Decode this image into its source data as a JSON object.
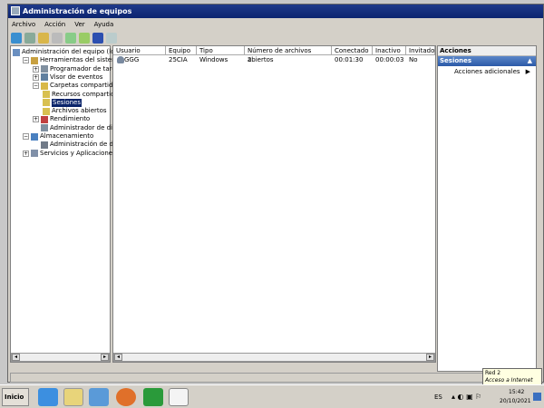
{
  "window": {
    "title": "Administración de equipos"
  },
  "menu": [
    "Archivo",
    "Acción",
    "Ver",
    "Ayuda"
  ],
  "tree": [
    {
      "label": "Administración del equipo (local)",
      "level": 0,
      "exp": ""
    },
    {
      "label": "Herramientas del sistema",
      "level": 1,
      "exp": "−"
    },
    {
      "label": "Programador de tareas",
      "level": 2,
      "exp": "+"
    },
    {
      "label": "Visor de eventos",
      "level": 2,
      "exp": "+"
    },
    {
      "label": "Carpetas compartidas",
      "level": 2,
      "exp": "−"
    },
    {
      "label": "Recursos compartidos",
      "level": 3,
      "exp": ""
    },
    {
      "label": "Sesiones",
      "level": 3,
      "exp": "",
      "selected": true
    },
    {
      "label": "Archivos abiertos",
      "level": 3,
      "exp": ""
    },
    {
      "label": "Rendimiento",
      "level": 2,
      "exp": "+"
    },
    {
      "label": "Administrador de dispositi",
      "level": 2,
      "exp": ""
    },
    {
      "label": "Almacenamiento",
      "level": 1,
      "exp": "−"
    },
    {
      "label": "Administración de discos",
      "level": 2,
      "exp": ""
    },
    {
      "label": "Servicios y Aplicaciones",
      "level": 1,
      "exp": "+"
    }
  ],
  "list": {
    "columns": [
      "Usuario",
      "Equipo",
      "Tipo",
      "Número de archivos abiertos",
      "Conectado",
      "Inactivo",
      "Invitado"
    ],
    "rows": [
      [
        "GGG",
        "25CIA",
        "Windows",
        "2",
        "00:01:30",
        "00:00:03",
        "No"
      ]
    ]
  },
  "actions": {
    "header": "Acciones",
    "section": "Sesiones",
    "item": "Acciones adicionales"
  },
  "tooltip": {
    "line1": "Red 2",
    "line2": "Acceso a Internet"
  },
  "taskbar": {
    "start": "Inicio",
    "lang": "ES",
    "time": "15:42",
    "date": "20/10/2021"
  }
}
